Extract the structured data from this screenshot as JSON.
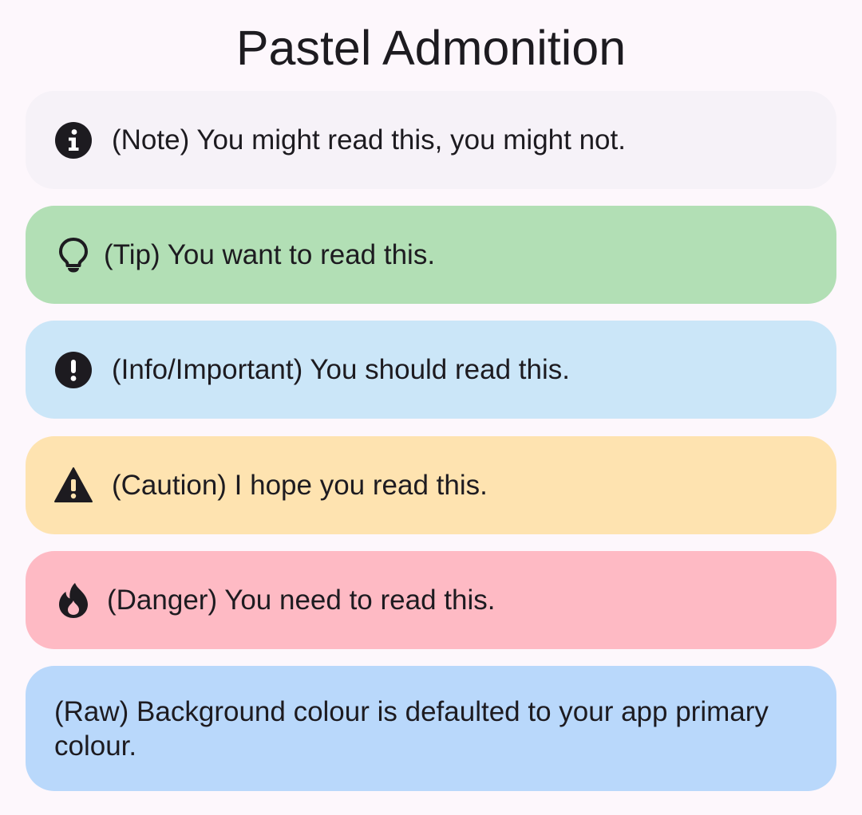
{
  "title": "Pastel Admonition",
  "colors": {
    "page_background": "#fdf7fc",
    "note": "#f6f2f8",
    "tip": "#b2dfb5",
    "info": "#cbe6f8",
    "caution": "#fee3b0",
    "danger": "#febac4",
    "raw": "#b9d8fb",
    "icon": "#1d1b20"
  },
  "admonitions": [
    {
      "kind": "note",
      "icon": "info-circle-icon",
      "text": "(Note) You might read this, you might not."
    },
    {
      "kind": "tip",
      "icon": "lightbulb-icon",
      "text": "(Tip) You want to read this."
    },
    {
      "kind": "info",
      "icon": "exclamation-circle-icon",
      "text": "(Info/Important) You should read this."
    },
    {
      "kind": "caution",
      "icon": "warning-triangle-icon",
      "text": "(Caution) I hope you read this."
    },
    {
      "kind": "danger",
      "icon": "flame-icon",
      "text": "(Danger) You need to read this."
    },
    {
      "kind": "raw",
      "icon": "",
      "text": "(Raw) Background colour is defaulted to your app primary colour."
    }
  ]
}
